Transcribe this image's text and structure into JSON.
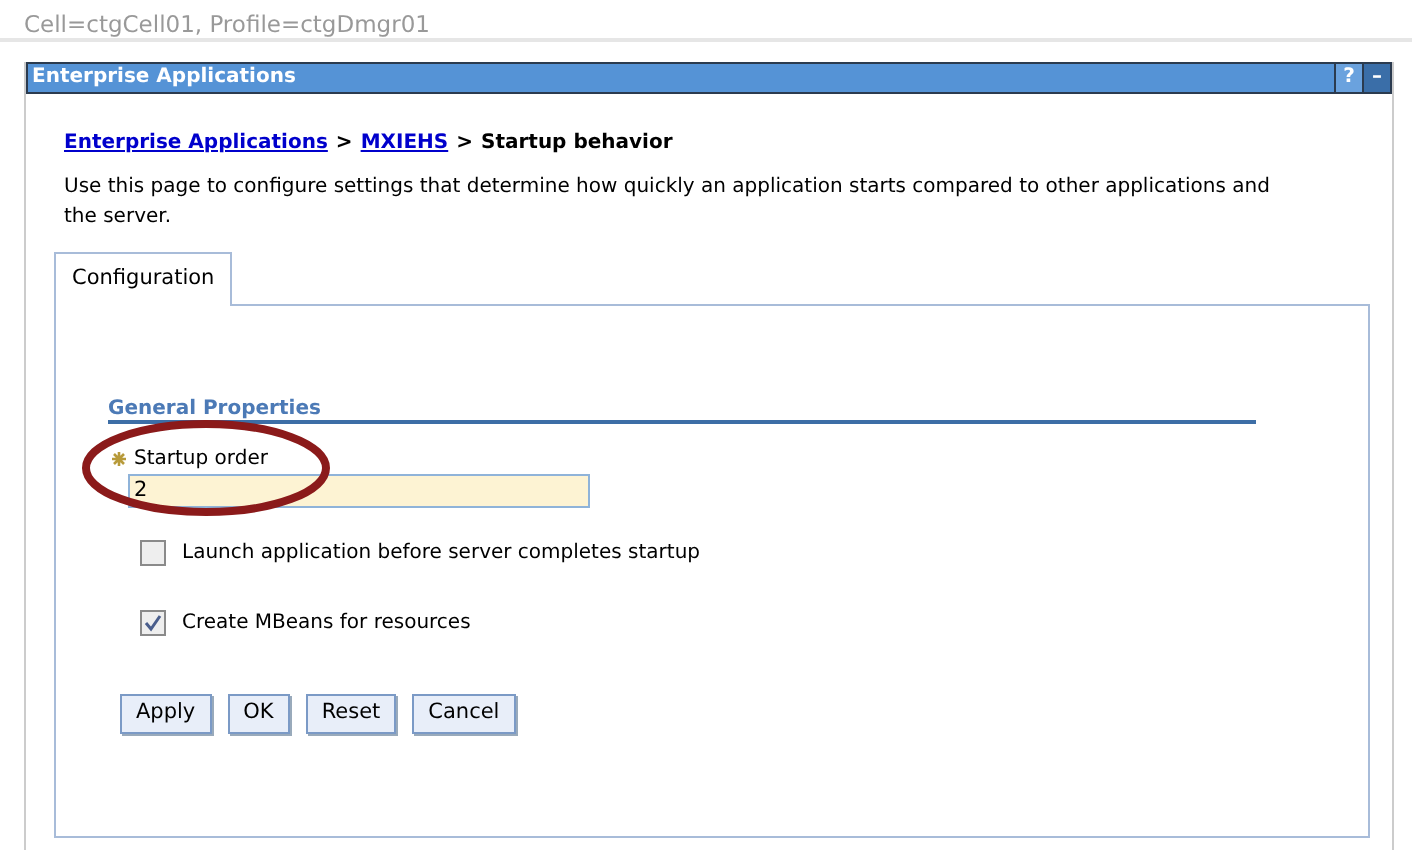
{
  "context": "Cell=ctgCell01, Profile=ctgDmgr01",
  "panel": {
    "title": "Enterprise Applications",
    "help_button": "?",
    "minimize_button": "–"
  },
  "breadcrumb": [
    {
      "label": "Enterprise Applications",
      "kind": "link"
    },
    {
      "label": "MXIEHS",
      "kind": "link"
    },
    {
      "label": "Startup behavior",
      "kind": "current"
    }
  ],
  "breadcrumb_separator": ">",
  "description": "Use this page to configure settings that determine how quickly an application starts compared to other applications and the server.",
  "tabs": [
    {
      "label": "Configuration",
      "selected": true
    }
  ],
  "section_title": "General Properties",
  "startup_order": {
    "label": "Startup order",
    "required": true,
    "value": "2",
    "highlighted": true
  },
  "options": [
    {
      "label": "Launch application before server completes startup",
      "checked": false
    },
    {
      "label": "Create MBeans for resources",
      "checked": true
    }
  ],
  "buttons": [
    "Apply",
    "OK",
    "Reset",
    "Cancel"
  ]
}
